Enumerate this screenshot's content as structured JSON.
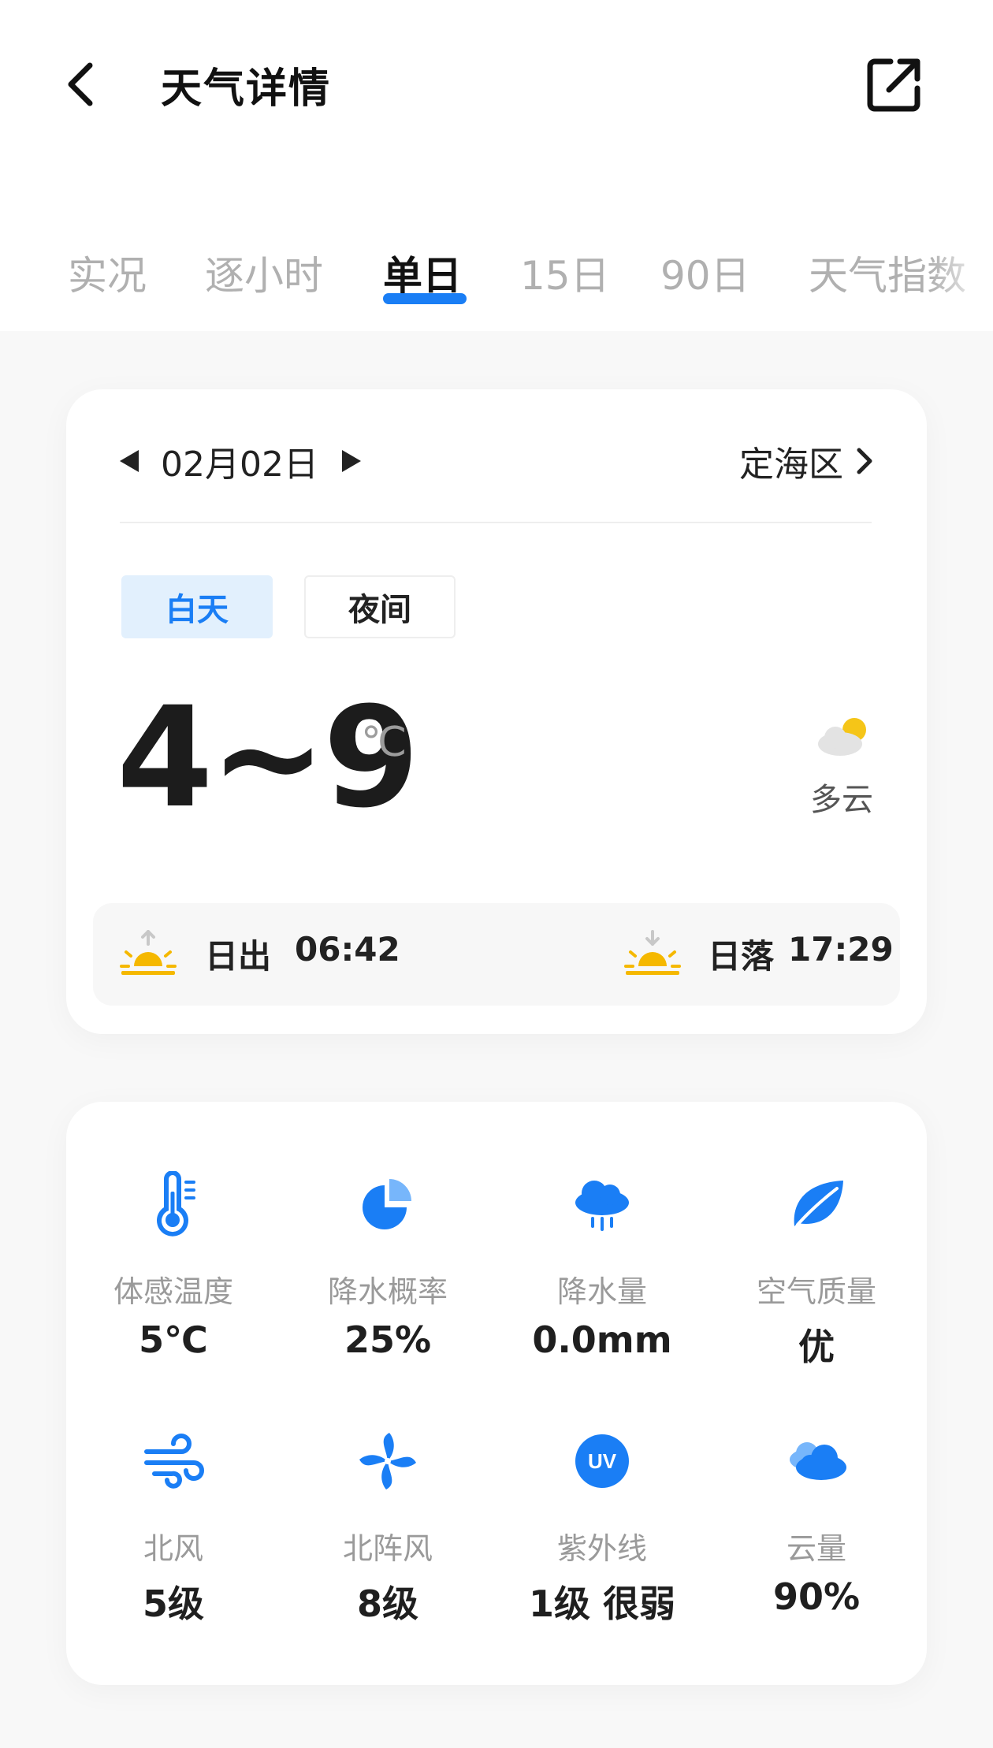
{
  "header": {
    "title": "天气详情"
  },
  "tabs": [
    {
      "label": "实况"
    },
    {
      "label": "逐小时"
    },
    {
      "label": "单日"
    },
    {
      "label": "15日"
    },
    {
      "label": "90日"
    },
    {
      "label": "天气指数"
    }
  ],
  "active_tab": "单日",
  "forecast": {
    "date": "02月02日",
    "location": "定海区",
    "period_day": "白天",
    "period_night": "夜间",
    "temperature_range": "4~9",
    "unit": "℃",
    "condition": "多云",
    "sunrise_label": "日出",
    "sunrise_time": "06:42",
    "sunset_label": "日落",
    "sunset_time": "17:29"
  },
  "details": [
    {
      "label": "体感温度",
      "value": "5℃",
      "icon": "thermometer-icon"
    },
    {
      "label": "降水概率",
      "value": "25%",
      "icon": "pie-chart-icon"
    },
    {
      "label": "降水量",
      "value": "0.0mm",
      "icon": "rain-cloud-icon"
    },
    {
      "label": "空气质量",
      "value": "优",
      "icon": "leaf-icon"
    },
    {
      "label": "北风",
      "value": "5级",
      "icon": "wind-icon"
    },
    {
      "label": "北阵风",
      "value": "8级",
      "icon": "pinwheel-icon"
    },
    {
      "label": "紫外线",
      "value": "1级 很弱",
      "icon": "uv-icon",
      "icon_text": "UV"
    },
    {
      "label": "云量",
      "value": "90%",
      "icon": "cloud-icon"
    }
  ],
  "colors": {
    "accent": "#1a7ef5",
    "sun": "#f5b800",
    "text_primary": "#1c1c1c",
    "text_secondary": "#9a9a9a"
  }
}
